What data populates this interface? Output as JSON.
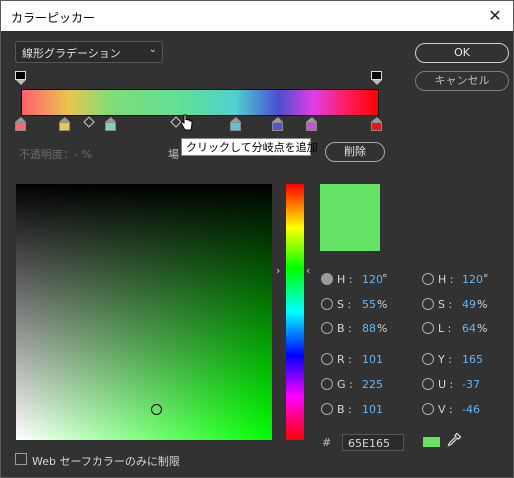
{
  "window": {
    "title": "カラーピッカー",
    "close_glyph": "✕"
  },
  "gradient_type": {
    "label": "線形グラデーション",
    "chevron": "⌄"
  },
  "buttons": {
    "ok": "OK",
    "cancel": "キャンセル",
    "delete": "削除"
  },
  "opacity_row": {
    "label": "不透明度：- %",
    "location_label": "場"
  },
  "tooltip": "クリックして分岐点を追加",
  "gradient_stops_colors": [
    "#f46b74",
    "#e8c94a",
    "#7fd6b7",
    "#56c8d4",
    "#5454d0",
    "#c84fd8",
    "#e01818"
  ],
  "current_color": "#65E165",
  "hsb": {
    "h": {
      "label": "H :",
      "value": "120",
      "unit": "°"
    },
    "s": {
      "label": "S :",
      "value": "55",
      "unit": "%"
    },
    "b": {
      "label": "B :",
      "value": "88",
      "unit": "%"
    }
  },
  "rgb": {
    "r": {
      "label": "R :",
      "value": "101"
    },
    "g": {
      "label": "G :",
      "value": "225"
    },
    "b": {
      "label": "B :",
      "value": "101"
    }
  },
  "hsl": {
    "h": {
      "label": "H :",
      "value": "120",
      "unit": "°"
    },
    "s": {
      "label": "S :",
      "value": "49",
      "unit": "%"
    },
    "l": {
      "label": "L :",
      "value": "64",
      "unit": "%"
    }
  },
  "yuv": {
    "y": {
      "label": "Y :",
      "value": "165"
    },
    "u": {
      "label": "U :",
      "value": "-37"
    },
    "v": {
      "label": "V :",
      "value": "-46"
    }
  },
  "hex": {
    "prefix": "#",
    "value": "65E165"
  },
  "web_safe": {
    "label": "Web セーフカラーのみに制限"
  }
}
